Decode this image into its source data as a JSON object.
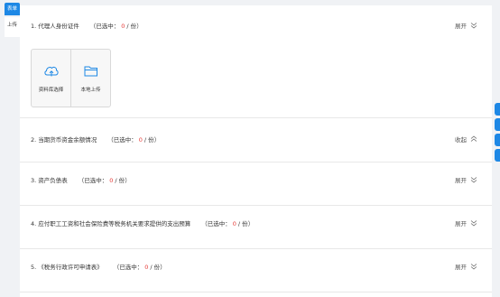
{
  "side_tabs": {
    "form": "表单",
    "upload": "上传"
  },
  "count_label": "已选中：",
  "count_unit": "/ 份",
  "sections": [
    {
      "title": "1. 代理人身份证件",
      "count": "0",
      "toggle": "展开",
      "state": "expanded"
    },
    {
      "title": "2. 当期货币资金余额情况",
      "count": "0",
      "toggle": "收起",
      "state": "collapsible"
    },
    {
      "title": "3. 资产负债表",
      "count": "0",
      "toggle": "展开",
      "state": "collapsed"
    },
    {
      "title": "4. 应付职工工资和社会保险费等税务机关要求提供的支出预算",
      "count": "0",
      "toggle": "展开",
      "state": "collapsed"
    },
    {
      "title": "5. 《税务行政许可申请表》",
      "count": "0",
      "toggle": "展开",
      "state": "collapsed"
    }
  ],
  "upload": {
    "library": "资料库选择",
    "local": "本地上传"
  },
  "colors": {
    "accent": "#1e88e5",
    "count_highlight": "#e53935"
  },
  "icons": {
    "library": "cloud-upload-icon",
    "local": "folder-icon",
    "expand": "chevron-down-icon",
    "collapse": "chevron-up-icon"
  }
}
